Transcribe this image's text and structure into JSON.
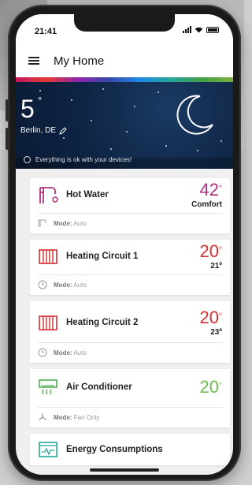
{
  "status_bar": {
    "time": "21:41"
  },
  "app_bar": {
    "title": "My Home"
  },
  "weather": {
    "temperature": "5",
    "degree_symbol": "°",
    "location": "Berlin, DE",
    "status_message": "Everything is ok with your devices!"
  },
  "devices": [
    {
      "name": "Hot Water",
      "value": "42",
      "unit": "°",
      "sub": "Comfort",
      "mode_label": "Mode:",
      "mode_value": "Auto",
      "color": "#b0307f"
    },
    {
      "name": "Heating Circuit 1",
      "value": "20",
      "unit": "°",
      "sub": "21º",
      "mode_label": "Mode:",
      "mode_value": "Auto",
      "color": "#d32f2f"
    },
    {
      "name": "Heating Circuit 2",
      "value": "20",
      "unit": "°",
      "sub": "23º",
      "mode_label": "Mode:",
      "mode_value": "Auto",
      "color": "#d32f2f"
    },
    {
      "name": "Air Conditioner",
      "value": "20",
      "unit": "°",
      "sub": "",
      "mode_label": "Mode:",
      "mode_value": "Fan Only",
      "color": "#6dbb4f"
    }
  ],
  "energy": {
    "name": "Energy Consumptions"
  }
}
